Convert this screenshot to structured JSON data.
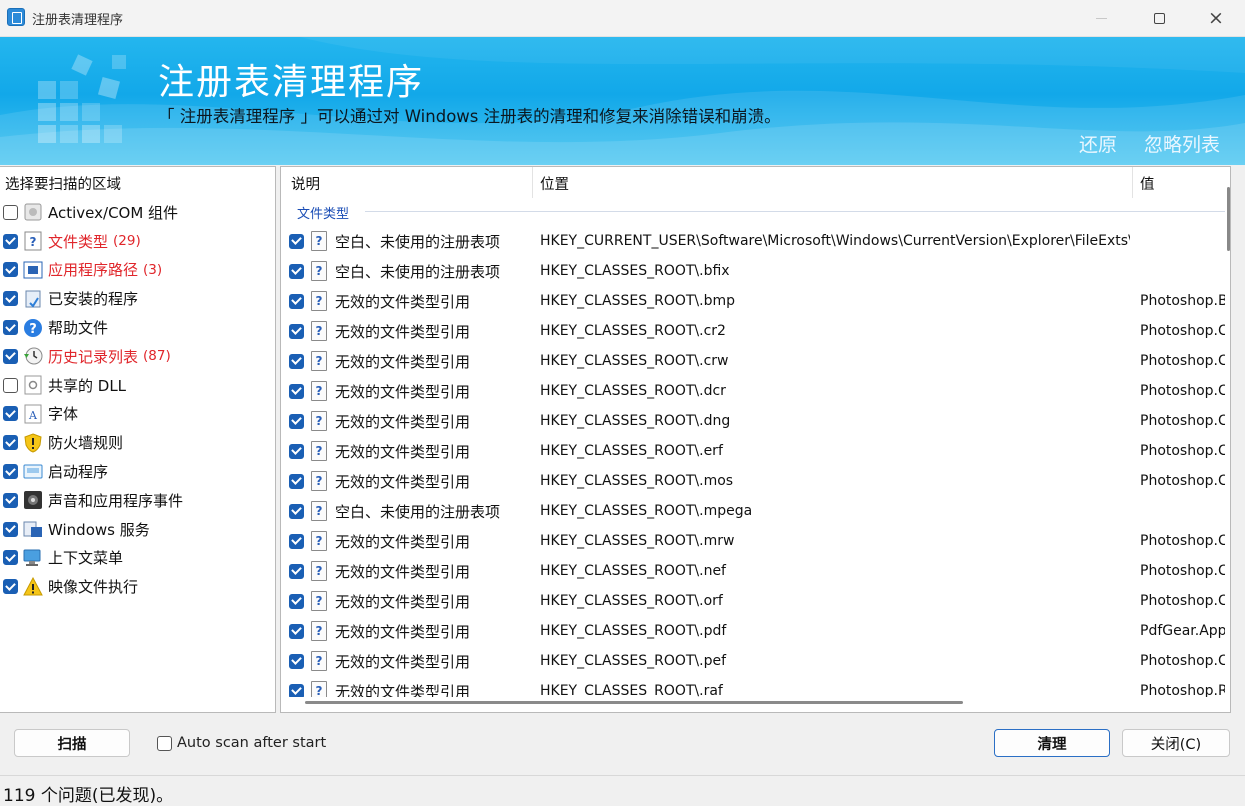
{
  "window": {
    "title": "注册表清理程序",
    "minimize": "—",
    "maximize": "□",
    "close": "×"
  },
  "banner": {
    "title": "注册表清理程序",
    "description": "「 注册表清理程序 」可以通过对 Windows 注册表的清理和修复来消除错误和崩溃。",
    "restore_link": "还原",
    "ignore_list_link": "忽略列表"
  },
  "areas": {
    "header": "选择要扫描的区域",
    "items": [
      {
        "label": "Activex/COM 组件",
        "checked": false,
        "count": "",
        "icon": "activex-icon"
      },
      {
        "label": "文件类型",
        "checked": true,
        "count": "(29)",
        "icon": "file-type-icon"
      },
      {
        "label": "应用程序路径",
        "checked": true,
        "count": "(3)",
        "icon": "app-path-icon"
      },
      {
        "label": "已安装的程序",
        "checked": true,
        "count": "",
        "icon": "installed-programs-icon"
      },
      {
        "label": "帮助文件",
        "checked": true,
        "count": "",
        "icon": "help-icon"
      },
      {
        "label": "历史记录列表",
        "checked": true,
        "count": "(87)",
        "icon": "history-icon"
      },
      {
        "label": "共享的 DLL",
        "checked": false,
        "count": "",
        "icon": "dll-icon"
      },
      {
        "label": "字体",
        "checked": true,
        "count": "",
        "icon": "font-icon"
      },
      {
        "label": "防火墙规则",
        "checked": true,
        "count": "",
        "icon": "firewall-icon"
      },
      {
        "label": "启动程序",
        "checked": true,
        "count": "",
        "icon": "startup-icon"
      },
      {
        "label": "声音和应用程序事件",
        "checked": true,
        "count": "",
        "icon": "sound-icon"
      },
      {
        "label": "Windows 服务",
        "checked": true,
        "count": "",
        "icon": "service-icon"
      },
      {
        "label": "上下文菜单",
        "checked": true,
        "count": "",
        "icon": "context-menu-icon"
      },
      {
        "label": "映像文件执行",
        "checked": true,
        "count": "",
        "icon": "warning-icon"
      }
    ]
  },
  "results": {
    "columns": [
      "说明",
      "位置",
      "值"
    ],
    "group": "文件类型",
    "rows": [
      {
        "desc": "空白、未使用的注册表项",
        "loc": "HKEY_CURRENT_USER\\Software\\Microsoft\\Windows\\CurrentVersion\\Explorer\\FileExts\\...",
        "val": ""
      },
      {
        "desc": "空白、未使用的注册表项",
        "loc": "HKEY_CLASSES_ROOT\\.bfix",
        "val": ""
      },
      {
        "desc": "无效的文件类型引用",
        "loc": "HKEY_CLASSES_ROOT\\.bmp",
        "val": "Photoshop.B"
      },
      {
        "desc": "无效的文件类型引用",
        "loc": "HKEY_CLASSES_ROOT\\.cr2",
        "val": "Photoshop.C"
      },
      {
        "desc": "无效的文件类型引用",
        "loc": "HKEY_CLASSES_ROOT\\.crw",
        "val": "Photoshop.C"
      },
      {
        "desc": "无效的文件类型引用",
        "loc": "HKEY_CLASSES_ROOT\\.dcr",
        "val": "Photoshop.C"
      },
      {
        "desc": "无效的文件类型引用",
        "loc": "HKEY_CLASSES_ROOT\\.dng",
        "val": "Photoshop.C"
      },
      {
        "desc": "无效的文件类型引用",
        "loc": "HKEY_CLASSES_ROOT\\.erf",
        "val": "Photoshop.C"
      },
      {
        "desc": "无效的文件类型引用",
        "loc": "HKEY_CLASSES_ROOT\\.mos",
        "val": "Photoshop.C"
      },
      {
        "desc": "空白、未使用的注册表项",
        "loc": "HKEY_CLASSES_ROOT\\.mpega",
        "val": ""
      },
      {
        "desc": "无效的文件类型引用",
        "loc": "HKEY_CLASSES_ROOT\\.mrw",
        "val": "Photoshop.C"
      },
      {
        "desc": "无效的文件类型引用",
        "loc": "HKEY_CLASSES_ROOT\\.nef",
        "val": "Photoshop.C"
      },
      {
        "desc": "无效的文件类型引用",
        "loc": "HKEY_CLASSES_ROOT\\.orf",
        "val": "Photoshop.C"
      },
      {
        "desc": "无效的文件类型引用",
        "loc": "HKEY_CLASSES_ROOT\\.pdf",
        "val": "PdfGear.App"
      },
      {
        "desc": "无效的文件类型引用",
        "loc": "HKEY_CLASSES_ROOT\\.pef",
        "val": "Photoshop.C"
      },
      {
        "desc": "无效的文件类型引用",
        "loc": "HKEY_CLASSES_ROOT\\.raf",
        "val": "Photoshop.R"
      }
    ]
  },
  "bottom": {
    "scan_button": "扫描",
    "auto_scan_label": "Auto scan after start",
    "clean_button": "清理",
    "close_button": "关闭(C)"
  },
  "status": {
    "text": "119  个问题(已发现)。"
  },
  "colors": {
    "banner": "#12a8e9",
    "issue_red": "#e0262b",
    "checkbox_blue": "#1a5fb4",
    "group_blue": "#1a4db5"
  }
}
